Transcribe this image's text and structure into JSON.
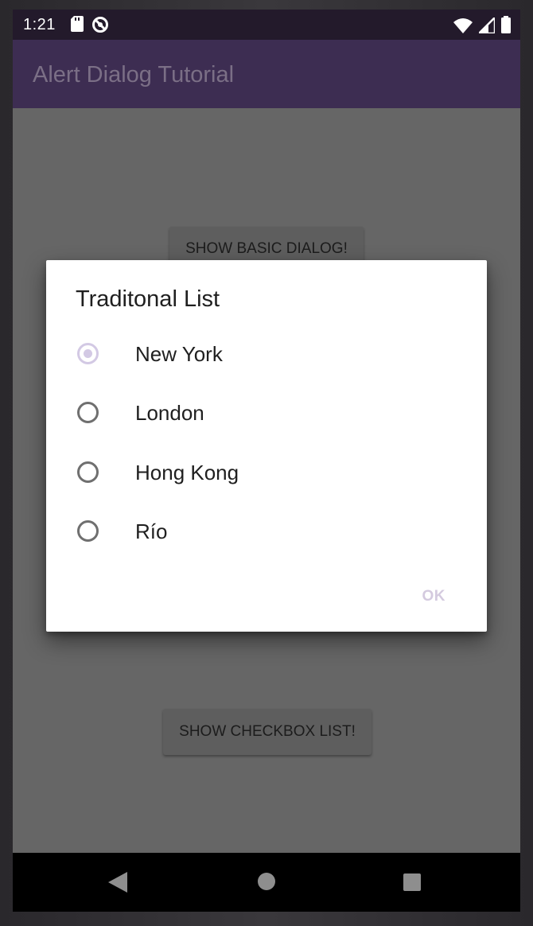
{
  "status_bar": {
    "time": "1:21",
    "left_icons": [
      "sd-card-icon",
      "do-not-disturb-icon"
    ],
    "right_icons": [
      "wifi-icon",
      "cell-signal-icon",
      "battery-icon"
    ]
  },
  "app_bar": {
    "title": "Alert Dialog Tutorial"
  },
  "background_buttons": {
    "basic_dialog": "SHOW BASIC DIALOG!",
    "checkbox_list": "SHOW CHECKBOX LIST!"
  },
  "dialog": {
    "title": "Traditonal List",
    "selected_index": 0,
    "options": [
      {
        "label": "New York",
        "selected": true
      },
      {
        "label": "London",
        "selected": false
      },
      {
        "label": "Hong Kong",
        "selected": false
      },
      {
        "label": "Río",
        "selected": false
      }
    ],
    "ok_label": "OK"
  },
  "nav_bar": {
    "icons": [
      "back-icon",
      "home-icon",
      "recents-icon"
    ]
  },
  "colors": {
    "app_bar": "#3d2d52",
    "status_bar": "#231a2b",
    "scrim_content": "#666666",
    "accent_disabled": "#d3c9e4"
  }
}
